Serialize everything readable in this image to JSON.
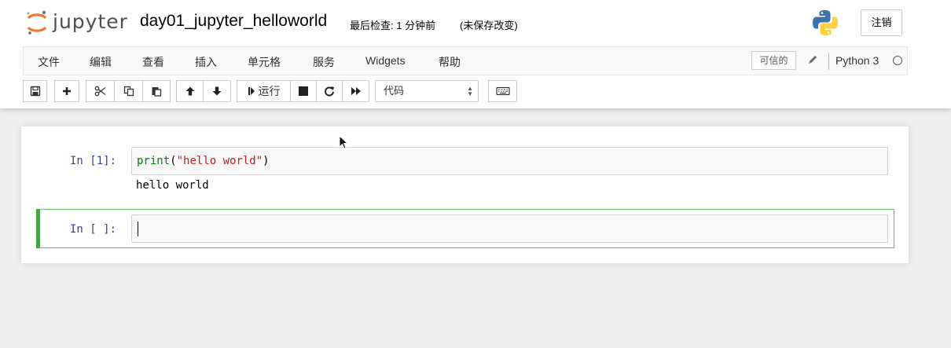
{
  "header": {
    "logo_text": "jupyter",
    "notebook_title": "day01_jupyter_helloworld",
    "checkpoint": "最后检查: 1 分钟前",
    "unsaved": "(未保存改变)",
    "logout_label": "注销"
  },
  "menubar": {
    "items": [
      "文件",
      "编辑",
      "查看",
      "插入",
      "单元格",
      "服务",
      "Widgets",
      "帮助"
    ],
    "trusted_label": "可信的",
    "kernel_name": "Python 3"
  },
  "toolbar": {
    "run_label": "运行",
    "cell_type": "代码",
    "icons": [
      "save-icon",
      "plus-icon",
      "cut-icon",
      "copy-icon",
      "paste-icon",
      "arrow-up-icon",
      "arrow-down-icon",
      "step-forward-icon",
      "stop-icon",
      "refresh-icon",
      "fast-forward-icon",
      "keyboard-icon"
    ]
  },
  "cells": [
    {
      "prompt": "In [1]:",
      "code_func": "print",
      "code_open": "(",
      "code_string": "\"hello world\"",
      "code_close": ")",
      "output": "hello world"
    },
    {
      "prompt": "In [ ]:",
      "code": ""
    }
  ],
  "colors": {
    "prompt": "#303f9f",
    "selected_cell_border": "#42a447",
    "keyword": "#008000",
    "string": "#ba2121"
  }
}
